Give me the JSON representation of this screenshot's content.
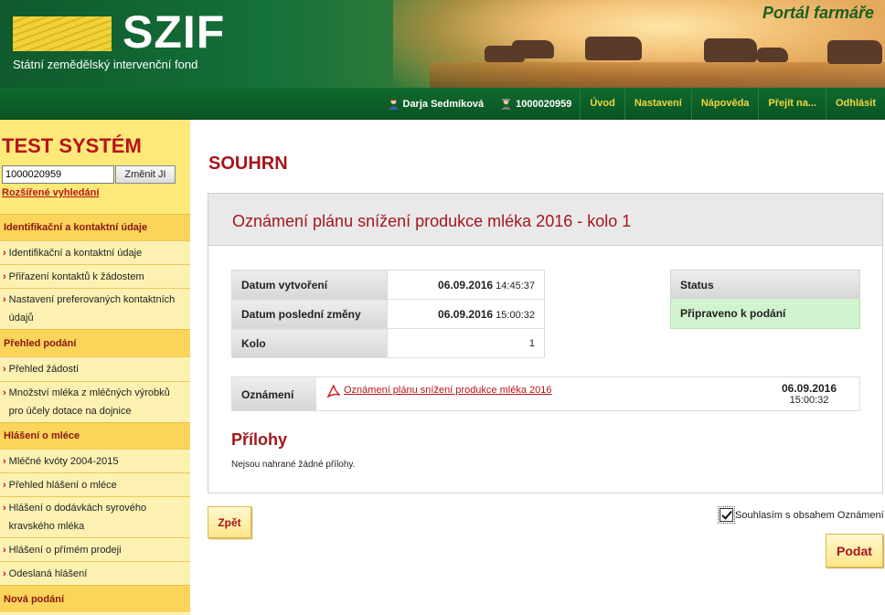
{
  "header": {
    "logo_text": "SZIF",
    "logo_subtitle": "Státní zemědělský intervenční fond",
    "portal_title": "Portál farmáře"
  },
  "navbar": {
    "user_name": "Darja Sedmíková",
    "user_icon": "user-icon",
    "ji_number": "1000020959",
    "ji_icon": "farmer-icon",
    "links": [
      "Úvod",
      "Nastavení",
      "Nápověda",
      "Přejít na...",
      "Odhlásit"
    ]
  },
  "sidebar": {
    "title": "TEST SYSTÉM",
    "ji_input_value": "1000020959",
    "change_button": "Změnit JI",
    "advanced_search": "Rozšířené vyhledání",
    "sections": [
      {
        "title": "Identifikační a kontaktní údaje",
        "items": [
          "Identifikační a kontaktní údaje",
          "Přiřazení kontaktů k žádostem",
          "Nastavení preferovaných kontaktních údajů"
        ]
      },
      {
        "title": "Přehled podání",
        "items": [
          "Přehled žádostí",
          "Množství mléka z mléčných výrobků pro účely dotace na dojnice"
        ]
      },
      {
        "title": "Hlášení o mléce",
        "items": [
          "Mléčné kvóty 2004-2015",
          "Přehled hlášení o mléce",
          "Hlášení o dodávkách syrového kravského mléka",
          "Hlášení o přímém prodeji",
          "Odeslaná hlášení"
        ]
      },
      {
        "title": "Nová podání",
        "items": []
      }
    ]
  },
  "main": {
    "page_title": "SOUHRN",
    "panel_title": "Oznámení plánu snížení produkce mléka 2016 - kolo 1",
    "info": {
      "created_label": "Datum vytvoření",
      "created_date": "06.09.2016",
      "created_time": "14:45:37",
      "modified_label": "Datum poslední změny",
      "modified_date": "06.09.2016",
      "modified_time": "15:00:32",
      "round_label": "Kolo",
      "round_value": "1"
    },
    "status": {
      "label": "Status",
      "value": "Připraveno k podání",
      "color": "#d2f3cf"
    },
    "notice": {
      "label": "Oznámení",
      "file_icon": "pdf-icon",
      "file_name": "Oznámení plánu snížení produkce mléka 2016",
      "date": "06.09.2016",
      "time": "15:00:32"
    },
    "attachments": {
      "title": "Přílohy",
      "empty_text": "Nejsou nahrané žádné přílohy."
    },
    "back_button": "Zpět",
    "agree_label": "Souhlasím s obsahem Oznámení",
    "agree_checked": true,
    "submit_button": "Podat"
  },
  "colors": {
    "accent_red": "#a5161c",
    "nav_green": "#0f6a2e",
    "nav_link_yellow": "#f5d642",
    "sidebar_bg": "#fdf1b2",
    "sidebar_section": "#fbd55a"
  }
}
